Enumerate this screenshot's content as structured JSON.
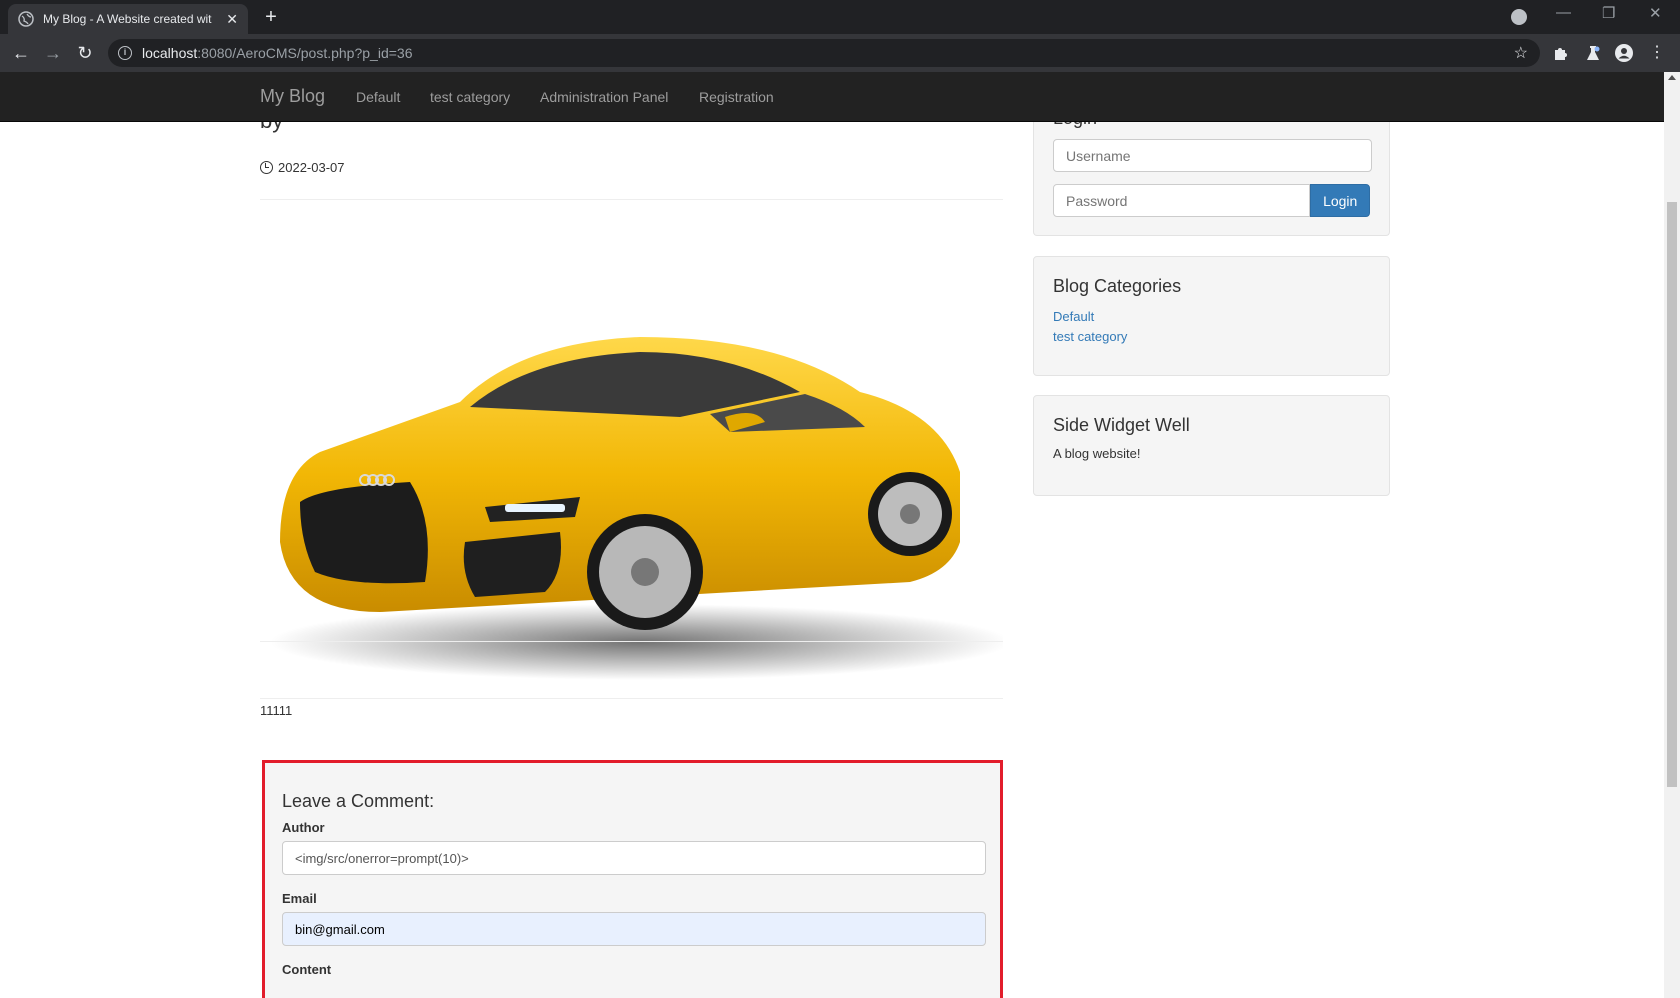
{
  "browser": {
    "tab_title": "My Blog - A Website created wit",
    "url_host": "localhost",
    "url_path": ":8080/AeroCMS/post.php?p_id=36"
  },
  "navbar": {
    "brand": "My Blog",
    "links": [
      "Default",
      "test category",
      "Administration Panel",
      "Registration"
    ]
  },
  "post": {
    "by": "by",
    "date": "2022-03-07",
    "image_alt": "Yellow Audi sport quattro concept car",
    "content": "11111"
  },
  "comment_form": {
    "title": "Leave a Comment:",
    "author_label": "Author",
    "author_value": "<img/src/onerror=prompt(10)>",
    "email_label": "Email",
    "email_value": "bin@gmail.com",
    "content_label": "Content",
    "highlight_color": "#e21c2b"
  },
  "sidebar": {
    "login": {
      "title": "Login",
      "username_placeholder": "Username",
      "password_placeholder": "Password",
      "button": "Login"
    },
    "categories": {
      "title": "Blog Categories",
      "items": [
        "Default",
        "test category"
      ]
    },
    "widget": {
      "title": "Side Widget Well",
      "text": "A blog website!"
    }
  },
  "colors": {
    "link": "#337ab7",
    "navbar_bg": "#222222",
    "car": "#f2b705"
  }
}
